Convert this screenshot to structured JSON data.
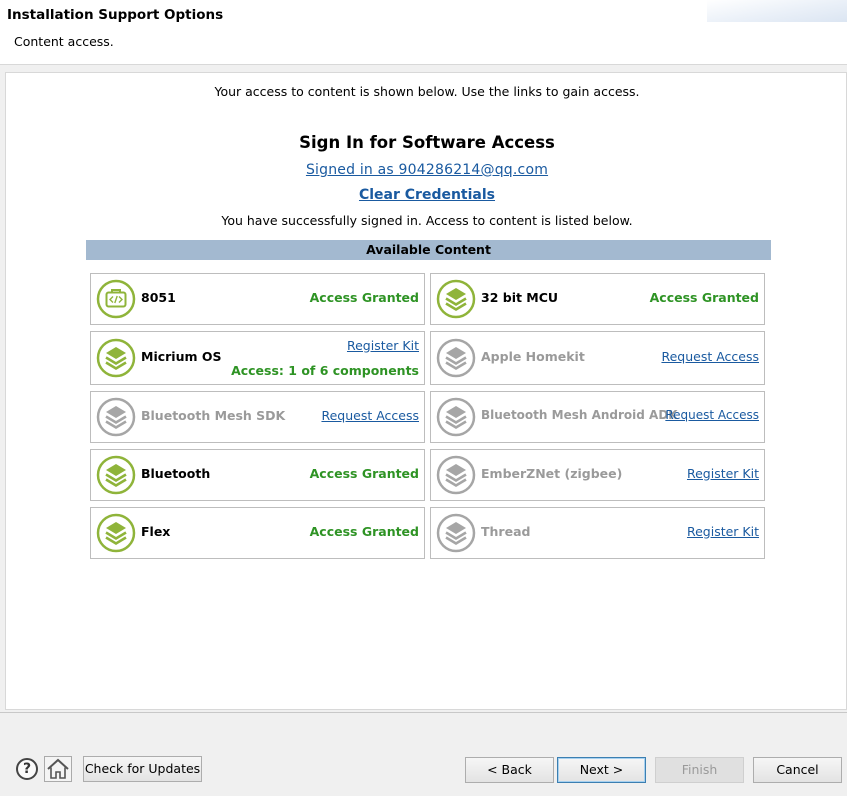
{
  "header": {
    "title": "Installation Support Options",
    "subtitle": "Content access."
  },
  "main": {
    "intro": "Your access to content is shown below. Use the links to gain access.",
    "signin_title": "Sign In for Software Access",
    "signed_in_link": "Signed in as 904286214@qq.com",
    "clear_credentials": "Clear Credentials",
    "status_message": "You have successfully signed in. Access to content is listed below.",
    "available_content_header": "Available Content",
    "items": [
      {
        "name": "8051",
        "status": "Access Granted",
        "icon": "code-briefcase-icon"
      },
      {
        "name": "32 bit MCU",
        "status": "Access Granted",
        "icon": "layers-icon"
      },
      {
        "name": "Micrium OS",
        "link": "Register Kit",
        "status": "Access: 1 of 6 components",
        "icon": "layers-icon"
      },
      {
        "name": "Apple Homekit",
        "link": "Request Access",
        "icon": "layers-icon"
      },
      {
        "name": "Bluetooth Mesh SDK",
        "link": "Request Access",
        "icon": "layers-icon"
      },
      {
        "name": "Bluetooth Mesh Android ADK",
        "link": "Request Access",
        "icon": "layers-icon"
      },
      {
        "name": "Bluetooth",
        "status": "Access Granted",
        "icon": "layers-icon"
      },
      {
        "name": "EmberZNet (zigbee)",
        "link": "Register Kit",
        "icon": "layers-icon"
      },
      {
        "name": "Flex",
        "status": "Access Granted",
        "icon": "layers-icon"
      },
      {
        "name": "Thread",
        "link": "Register Kit",
        "icon": "layers-icon"
      }
    ]
  },
  "footer": {
    "help_label": "?",
    "check_updates": "Check for Updates",
    "back": "< Back",
    "next": "Next >",
    "finish": "Finish",
    "cancel": "Cancel"
  },
  "colors": {
    "granted": "#2e9324",
    "link": "#1a5aa0",
    "icon_active": "#8fb43a",
    "icon_inactive": "#a6a6a6",
    "section_bar": "#a3b9d0"
  }
}
